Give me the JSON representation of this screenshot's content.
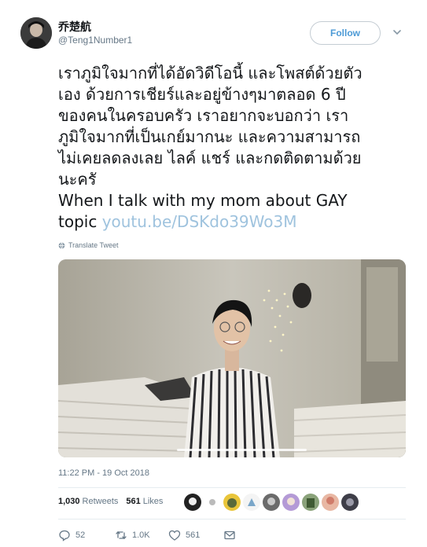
{
  "user": {
    "display_name": "乔楚航",
    "handle": "@Teng1Number1"
  },
  "follow_button": {
    "label": "Follow"
  },
  "tweet": {
    "lines": [
      "เราภูมิใจมากที่ได้อัดวิดีโอนี้ และโพสต์ด้วยตัว",
      "เอง ด้วยการเชียร์และอยู่ข้างๆมาตลอด 6 ปี",
      "ของคนในครอบครัว เราอยากจะบอกว่า เรา",
      "ภูมิใจมากที่เป็นเกย์มากนะ และความสามารถ",
      "ไม่เคยลดลงเลย ไลค์ แชร์ และกดติดตามด้วย",
      "นะครั",
      "When I talk with my mom about GAY"
    ],
    "last_line_prefix": "topic ",
    "link": "youtu.be/DSKdo39Wo3M",
    "translate_label": "Translate Tweet"
  },
  "media": {
    "progress": 1.0
  },
  "timestamp": "11:22 PM - 19 Oct 2018",
  "stats": {
    "retweets_count": "1,030",
    "retweets_label": "Retweets",
    "likes_count": "561",
    "likes_label": "Likes"
  },
  "actions": {
    "replies": "52",
    "retweets": "1.0K",
    "likes": "561"
  },
  "colors": {
    "link": "#9fc3de",
    "muted": "#657786",
    "follow": "#4c9ad6"
  }
}
